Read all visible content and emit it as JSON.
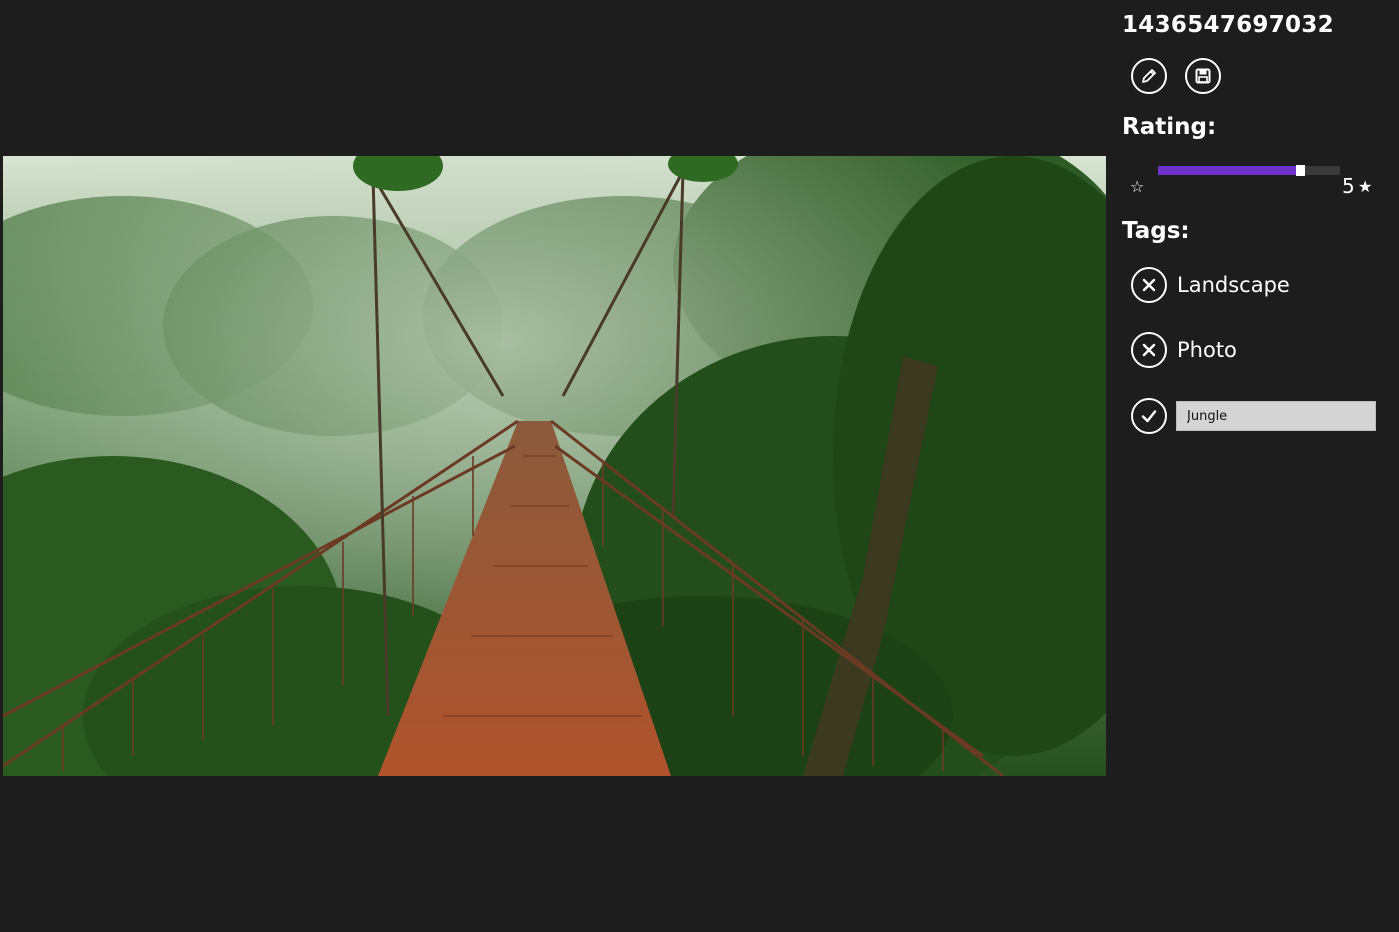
{
  "photo": {
    "title": "1436547697032",
    "description_icon": "photo-image"
  },
  "actions": {
    "edit_icon": "pencil-icon",
    "save_icon": "floppy-disk-icon"
  },
  "rating": {
    "label": "Rating:",
    "value": "5",
    "min_icon": "star-outline-icon",
    "max_icon": "star-filled-icon",
    "min_glyph": "☆",
    "max_glyph": "★",
    "accent_color": "#6b31c8",
    "fill_fraction": 0.78
  },
  "tags": {
    "label": "Tags:",
    "items": [
      {
        "label": "Landscape",
        "action_icon": "remove-icon"
      },
      {
        "label": "Photo",
        "action_icon": "remove-icon"
      }
    ],
    "new_tag": {
      "value": "Jungle",
      "action_icon": "confirm-check-icon"
    }
  }
}
